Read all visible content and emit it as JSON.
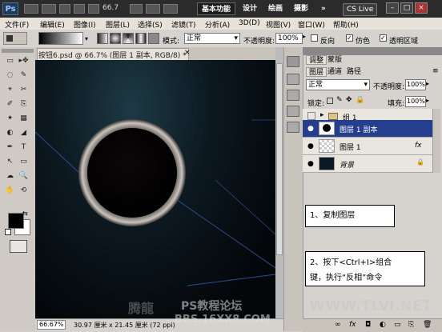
{
  "titlebar": {
    "logo": "Ps",
    "zoom": "66.7",
    "workspace_buttons": [
      "基本功能",
      "设计",
      "绘画",
      "摄影"
    ],
    "more": "»",
    "cs_live": "CS Live",
    "win_controls": [
      "–",
      "□",
      "×"
    ]
  },
  "menu": [
    "文件(F)",
    "编辑(E)",
    "图像(I)",
    "图层(L)",
    "选择(S)",
    "滤镜(T)",
    "分析(A)",
    "3D(D)",
    "视图(V)",
    "窗口(W)",
    "帮助(H)"
  ],
  "options": {
    "mode_label": "模式:",
    "mode_value": "正常",
    "opacity_label": "不透明度:",
    "opacity_value": "100%",
    "reverse": "反向",
    "dither": "仿色",
    "transparency": "透明区域"
  },
  "document": {
    "tab_title": "按钮6.psd @ 66.7% (图层 1 副本, RGB/8) *",
    "tab_close": "×",
    "status_zoom": "66.67%",
    "status_info": "30.97 厘米 x 21.45 厘米 (72 ppi)"
  },
  "panels": {
    "tabs_top": [
      "调整",
      "蒙版"
    ],
    "tabs_layers": [
      "图层",
      "通道",
      "路径"
    ],
    "blend_mode": "正常",
    "opacity_label": "不透明度:",
    "opacity_value": "100%",
    "lock_label": "锁定:",
    "fill_label": "填充:",
    "fill_value": "100%",
    "layers": [
      {
        "name": "组 1",
        "type": "group",
        "selected": false
      },
      {
        "name": "图层 1 副本",
        "type": "layer",
        "selected": true,
        "fx": ""
      },
      {
        "name": "图层 1",
        "type": "layer",
        "selected": false,
        "fx": "fx"
      },
      {
        "name": "背景",
        "type": "background",
        "selected": false,
        "lock": "🔒"
      }
    ]
  },
  "callouts": {
    "step1": "1、复制图层",
    "step2_line1": "2、按下<Ctrl+I>组合",
    "step2_line2": "键，执行“反相”命令"
  },
  "watermarks": {
    "forum": "PS教程论坛",
    "site1": "BBS.16XX8.COM",
    "site2": "WWW.TLVI.NET",
    "left": "腾龍"
  },
  "tools": [
    "▭",
    "▸✥",
    "◌",
    "✎",
    "⌖",
    "✂",
    "✐",
    "⎘",
    "✦",
    "▦",
    "◐",
    "◢",
    "✒",
    "T",
    "↖",
    "▭",
    "☁",
    "🔍",
    "✋",
    "⟲"
  ]
}
